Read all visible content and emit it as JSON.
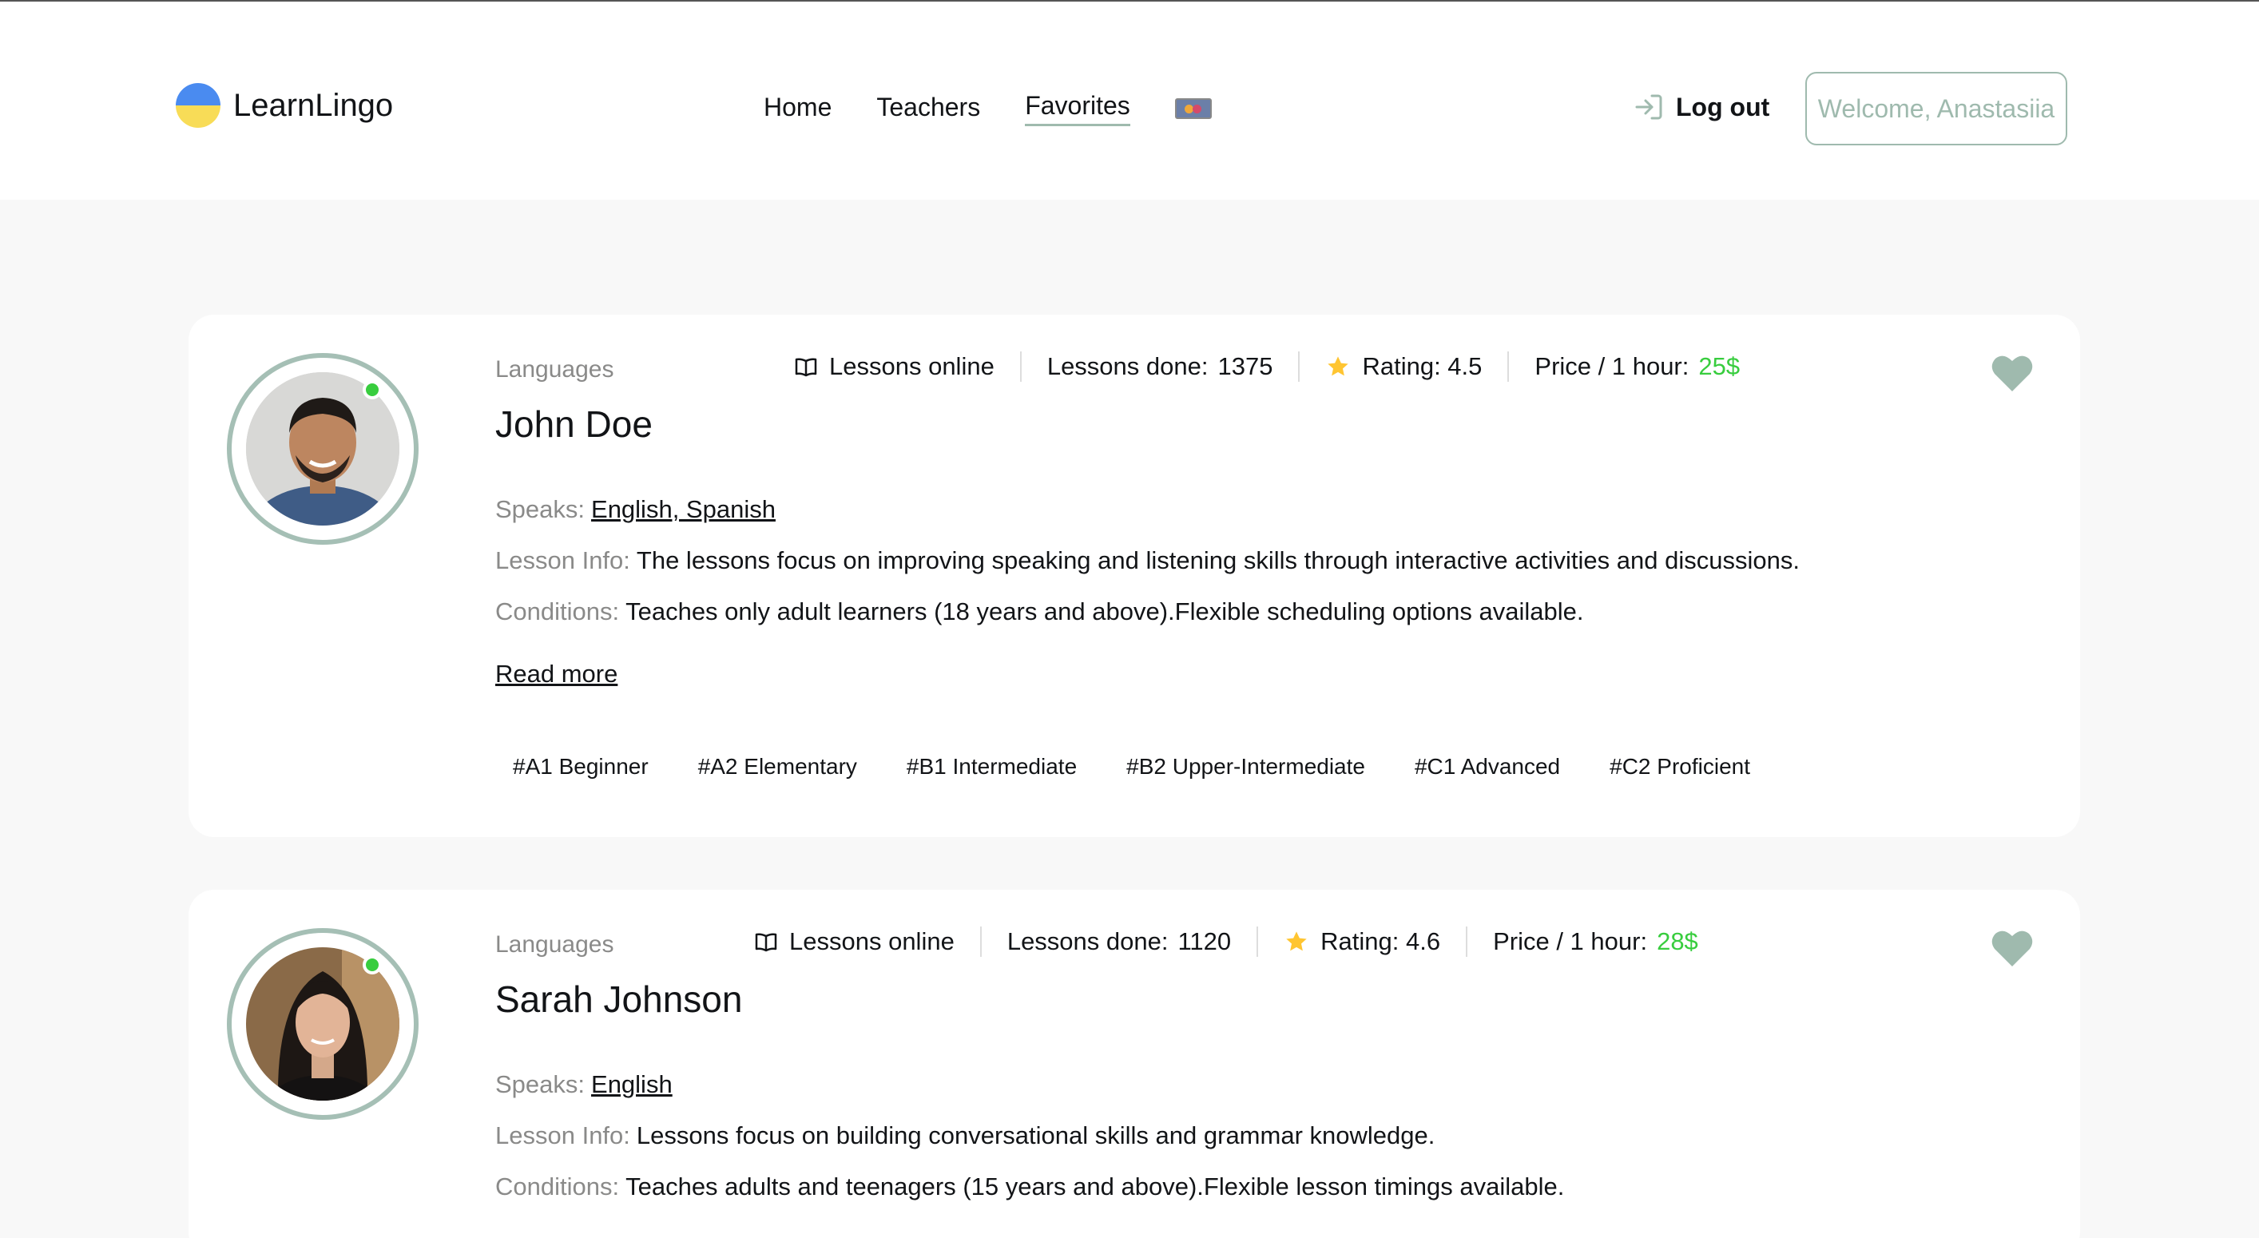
{
  "header": {
    "logo_text": "LearnLingo",
    "nav": [
      "Home",
      "Teachers",
      "Favorites"
    ],
    "active_nav": "Favorites",
    "logout_label": "Log out",
    "welcome_text": "Welcome, Anastasiia"
  },
  "colors": {
    "accent": "#9fbaae",
    "price": "#38cd3e",
    "online": "#38cd3e",
    "star": "#ffc531",
    "page_bg": "#f8f8f8"
  },
  "teachers": [
    {
      "languages_label": "Languages",
      "name": "John Doe",
      "lessons_online": "Lessons online",
      "lessons_done_label": "Lessons done:",
      "lessons_done": "1375",
      "rating": "Rating: 4.5",
      "price_label": "Price / 1 hour:",
      "price": "25$",
      "speaks_label": "Speaks:",
      "speaks": "English, Spanish",
      "lesson_info_label": "Lesson Info:",
      "lesson_info": "The lessons focus on improving speaking and listening skills through interactive activities and discussions.",
      "conditions_label": "Conditions:",
      "conditions": "Teaches only adult learners (18 years and above).Flexible scheduling options available.",
      "read_more": "Read more",
      "levels": [
        "#A1 Beginner",
        "#A2 Elementary",
        "#B1 Intermediate",
        "#B2 Upper-Intermediate",
        "#C1 Advanced",
        "#C2 Proficient"
      ]
    },
    {
      "languages_label": "Languages",
      "name": "Sarah Johnson",
      "lessons_online": "Lessons online",
      "lessons_done_label": "Lessons done:",
      "lessons_done": "1120",
      "rating": "Rating: 4.6",
      "price_label": "Price / 1 hour:",
      "price": "28$",
      "speaks_label": "Speaks:",
      "speaks": "English",
      "lesson_info_label": "Lesson Info:",
      "lesson_info": "Lessons focus on building conversational skills and grammar knowledge.",
      "conditions_label": "Conditions:",
      "conditions": "Teaches adults and teenagers (15 years and above).Flexible lesson timings available."
    }
  ]
}
